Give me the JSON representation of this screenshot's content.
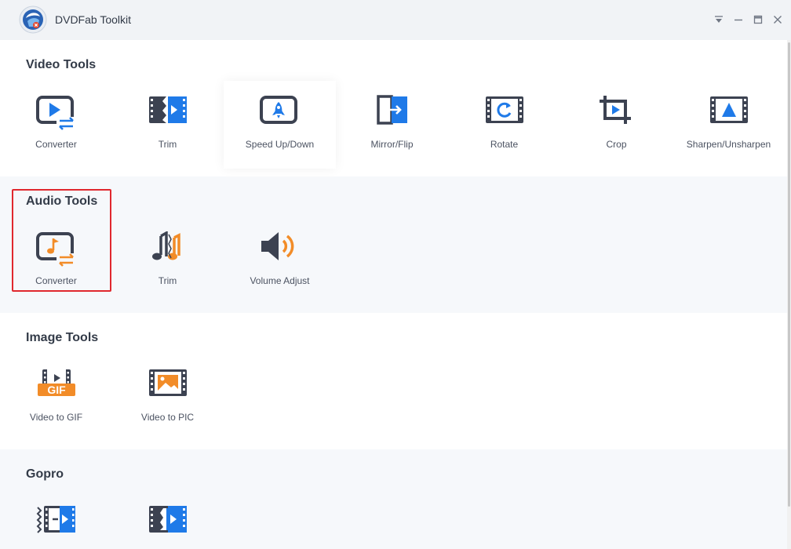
{
  "app": {
    "title": "DVDFab Toolkit"
  },
  "colors": {
    "accent_blue": "#1f7ae8",
    "accent_orange": "#f28c28",
    "dark": "#3c4251",
    "highlight": "#e0282e"
  },
  "window_controls": [
    {
      "icon": "menu-dropdown-icon"
    },
    {
      "icon": "minimize-icon"
    },
    {
      "icon": "maximize-icon"
    },
    {
      "icon": "close-icon"
    }
  ],
  "sections": {
    "video": {
      "title": "Video Tools",
      "tools": [
        {
          "label": "Converter",
          "icon": "video-converter-icon"
        },
        {
          "label": "Trim",
          "icon": "video-trim-icon"
        },
        {
          "label": "Speed Up/Down",
          "icon": "speed-rocket-icon"
        },
        {
          "label": "Mirror/Flip",
          "icon": "mirror-flip-icon"
        },
        {
          "label": "Rotate",
          "icon": "rotate-icon"
        },
        {
          "label": "Crop",
          "icon": "crop-icon"
        },
        {
          "label": "Sharpen/Unsharpen",
          "icon": "sharpen-icon"
        }
      ]
    },
    "audio": {
      "title": "Audio Tools",
      "tools": [
        {
          "label": "Converter",
          "icon": "audio-converter-icon"
        },
        {
          "label": "Trim",
          "icon": "audio-trim-icon"
        },
        {
          "label": "Volume Adjust",
          "icon": "volume-icon"
        }
      ]
    },
    "image": {
      "title": "Image Tools",
      "tools": [
        {
          "label": "Video to GIF",
          "icon": "gif-icon",
          "badge": "GIF"
        },
        {
          "label": "Video to PIC",
          "icon": "picture-icon"
        }
      ]
    },
    "gopro": {
      "title": "Gopro",
      "tools": [
        {
          "icon": "gopro-tool-1-icon"
        },
        {
          "icon": "gopro-tool-2-icon"
        }
      ]
    }
  }
}
